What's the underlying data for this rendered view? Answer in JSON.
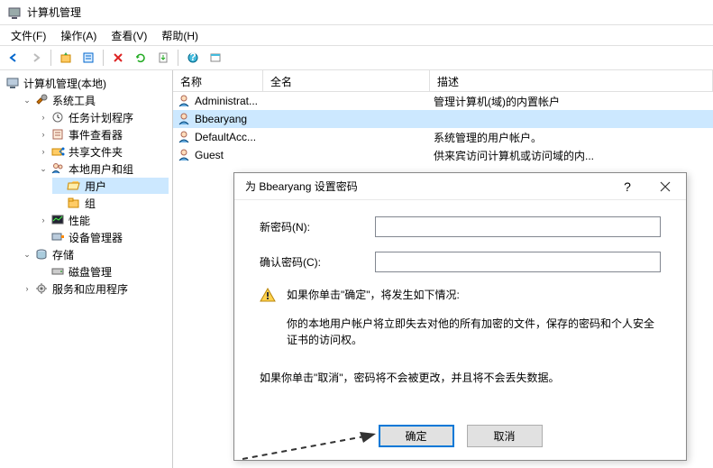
{
  "window": {
    "title": "计算机管理"
  },
  "menu": {
    "file": "文件(F)",
    "action": "操作(A)",
    "view": "查看(V)",
    "help": "帮助(H)"
  },
  "tree": {
    "root": "计算机管理(本地)",
    "system_tools": "系统工具",
    "task_scheduler": "任务计划程序",
    "event_viewer": "事件查看器",
    "shared_folders": "共享文件夹",
    "local_users_groups": "本地用户和组",
    "users": "用户",
    "groups": "组",
    "performance": "性能",
    "device_manager": "设备管理器",
    "storage": "存储",
    "disk_management": "磁盘管理",
    "services_apps": "服务和应用程序"
  },
  "columns": {
    "name": "名称",
    "full": "全名",
    "desc": "描述"
  },
  "rows": [
    {
      "name": "Administrat...",
      "full": "",
      "desc": "管理计算机(域)的内置帐户"
    },
    {
      "name": "Bbearyang",
      "full": "",
      "desc": ""
    },
    {
      "name": "DefaultAcc...",
      "full": "",
      "desc": "系统管理的用户帐户。"
    },
    {
      "name": "Guest",
      "full": "",
      "desc": "供来宾访问计算机或访问域的内..."
    }
  ],
  "dialog": {
    "title": "为 Bbearyang 设置密码",
    "new_password_label": "新密码(N):",
    "confirm_password_label": "确认密码(C):",
    "new_password_value": "",
    "confirm_password_value": "",
    "warning": "如果你单击\"确定\"，将发生如下情况:",
    "info": "你的本地用户帐户将立即失去对他的所有加密的文件，保存的密码和个人安全证书的访问权。",
    "note": "如果你单击\"取消\"，密码将不会被更改，并且将不会丢失数据。",
    "ok": "确定",
    "cancel": "取消"
  }
}
